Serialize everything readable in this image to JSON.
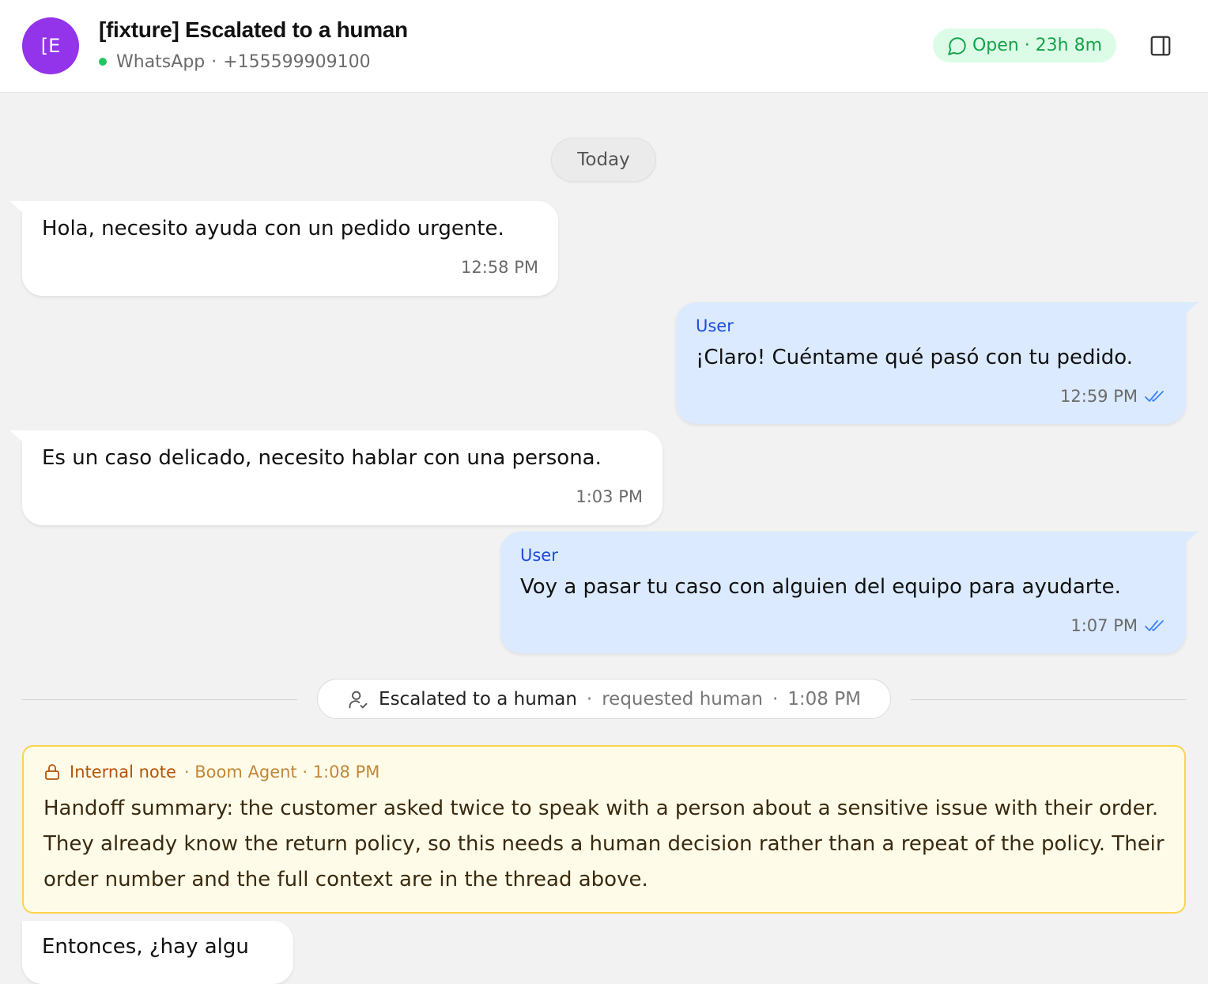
{
  "header": {
    "avatar_initials": "[E",
    "title": "[fixture] Escalated to a human",
    "channel": "WhatsApp",
    "separator": "·",
    "phone": "+155599909100",
    "status_label": "Open · 23h 8m",
    "status_icon": "chat-bubble-icon",
    "panel_icon": "sidebar-panel-icon"
  },
  "thread": {
    "date_label": "Today",
    "messages": [
      {
        "direction": "in",
        "text": "Hola, necesito ayuda con un pedido urgente.",
        "time": "12:58 PM"
      },
      {
        "direction": "out",
        "sender": "User",
        "text": "¡Claro! Cuéntame qué pasó con tu pedido.",
        "time": "12:59 PM",
        "receipt_icon": "double-check-icon"
      },
      {
        "direction": "in",
        "text": "Es un caso delicado, necesito hablar con una persona.",
        "time": "1:03 PM"
      },
      {
        "direction": "out",
        "sender": "User",
        "text": "Voy a pasar tu caso con alguien del equipo para ayudarte.",
        "time": "1:07 PM",
        "receipt_icon": "double-check-icon"
      }
    ],
    "event": {
      "icon": "user-check-icon",
      "label": "Escalated to a human",
      "separator": "·",
      "reason": "requested human",
      "time": "1:08 PM"
    },
    "note": {
      "icon": "lock-icon",
      "label": "Internal note",
      "meta": "· Boom Agent · 1:08 PM",
      "body": "Handoff summary: the customer asked twice to speak with a person about a sensitive issue with their order. They already know the return policy, so this needs a human decision rather than a repeat of the policy. Their order number and the full context are in the thread above."
    },
    "partial_message": {
      "text": "Entonces, ¿hay algu"
    }
  },
  "colors": {
    "avatar": "#9333ea",
    "online": "#22c55e",
    "status_bg": "#dcfce7",
    "status_text": "#16a34a",
    "outgoing_bg": "#dbeafe",
    "sender": "#1d4ed8",
    "note_bg": "#fefce8",
    "note_border": "#fcd34d",
    "note_label": "#b45309"
  }
}
